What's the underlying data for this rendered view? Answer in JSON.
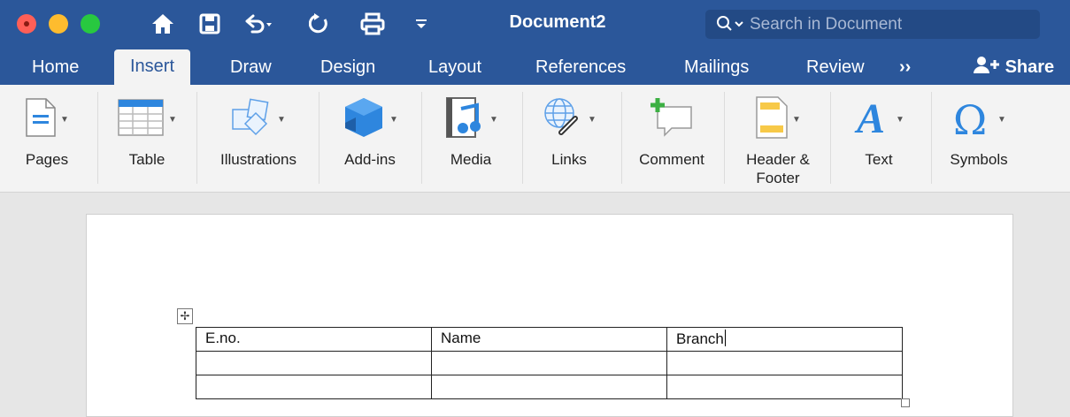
{
  "window": {
    "title": "Document2",
    "search_placeholder": "Search in Document"
  },
  "tabs": [
    {
      "label": "Home"
    },
    {
      "label": "Insert",
      "active": true
    },
    {
      "label": "Draw"
    },
    {
      "label": "Design"
    },
    {
      "label": "Layout"
    },
    {
      "label": "References"
    },
    {
      "label": "Mailings"
    },
    {
      "label": "Review"
    }
  ],
  "share_label": "Share",
  "ribbon": {
    "groups": [
      {
        "label": "Pages",
        "icon": "pages-icon"
      },
      {
        "label": "Table",
        "icon": "table-icon"
      },
      {
        "label": "Illustrations",
        "icon": "illustrations-icon"
      },
      {
        "label": "Add-ins",
        "icon": "addins-icon"
      },
      {
        "label": "Media",
        "icon": "media-icon"
      },
      {
        "label": "Links",
        "icon": "links-icon"
      },
      {
        "label": "Comment",
        "icon": "comment-icon"
      },
      {
        "label": "Header &\nFooter",
        "icon": "header-footer-icon"
      },
      {
        "label": "Text",
        "icon": "text-icon"
      },
      {
        "label": "Symbols",
        "icon": "symbols-icon"
      }
    ]
  },
  "document": {
    "table": {
      "rows": [
        [
          "E.no.",
          "Name",
          "Branch"
        ],
        [
          "",
          "",
          ""
        ],
        [
          "",
          "",
          ""
        ]
      ]
    }
  },
  "colors": {
    "brand": "#2b579a",
    "ribbon": "#f3f3f3",
    "canvas": "#e6e6e6"
  }
}
